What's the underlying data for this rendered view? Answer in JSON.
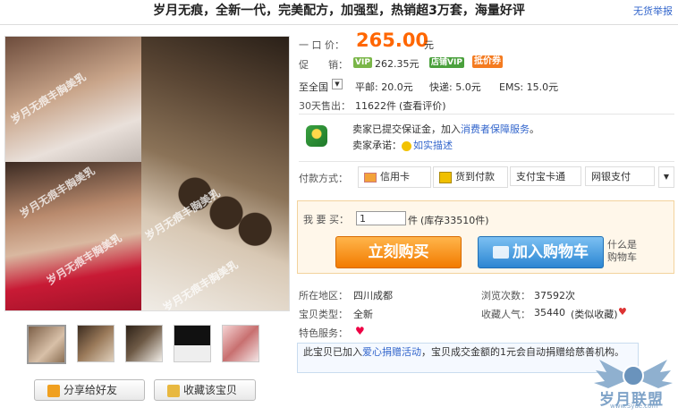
{
  "title": "岁月无痕，全新一代，完美配方，加强型，热销超3万套，海量好评",
  "report_link": "无货举报",
  "watermark": "岁月无痕丰胸美乳",
  "price": {
    "label": "一 口 价：",
    "value": "265.00",
    "unit": "元"
  },
  "promo": {
    "label": "促　　销：",
    "vip_badge": "VIP",
    "vip_price": "262.35元",
    "store_vip": "店铺VIP",
    "coupon": "抵价券"
  },
  "shipping": {
    "region": "至全国",
    "normal": "平邮: 20.0元",
    "express": "快递: 5.0元",
    "ems": "EMS: 15.0元"
  },
  "sales": {
    "label": "30天售出：",
    "count": "11622件",
    "link": "(查看评价)"
  },
  "seller": {
    "deposit_text": "卖家已提交保证金，",
    "join": "加入",
    "service_link": "消费者保障服务",
    "period": "。",
    "promise_label": "卖家承诺：",
    "promise_link": "如实描述"
  },
  "payment": {
    "label": "付款方式：",
    "methods": [
      "信用卡",
      "货到付款",
      "支付宝卡通",
      "网银支付"
    ]
  },
  "buy": {
    "qty_label": "我 要 买：",
    "qty_value": "1",
    "qty_unit": "件",
    "stock": "(库存33510件)",
    "buy_now": "立刻购买",
    "add_cart": "加入购物车",
    "cart_help": "什么是购物车"
  },
  "details": {
    "location_label": "所在地区：",
    "location": "四川成都",
    "views_label": "浏览次数：",
    "views": "37592次",
    "type_label": "宝贝类型：",
    "type": "全新",
    "popularity_label": "收藏人气：",
    "popularity": "35440",
    "popularity_link": "(类似收藏)",
    "service_label": "特色服务："
  },
  "notice": {
    "pre": "此宝贝已加入",
    "link": "爱心捐赠活动",
    "post": "，宝贝成交金额的1元会自动捐赠给慈善机构。"
  },
  "actions": {
    "share": "分享给好友",
    "favorite": "收藏该宝贝"
  },
  "logo": {
    "text": "岁月联盟",
    "url": "www.Syue.com"
  },
  "colors": {
    "price": "#ff6600",
    "link": "#3366cc",
    "buy": "#f27b00",
    "cart": "#2b86d2"
  }
}
